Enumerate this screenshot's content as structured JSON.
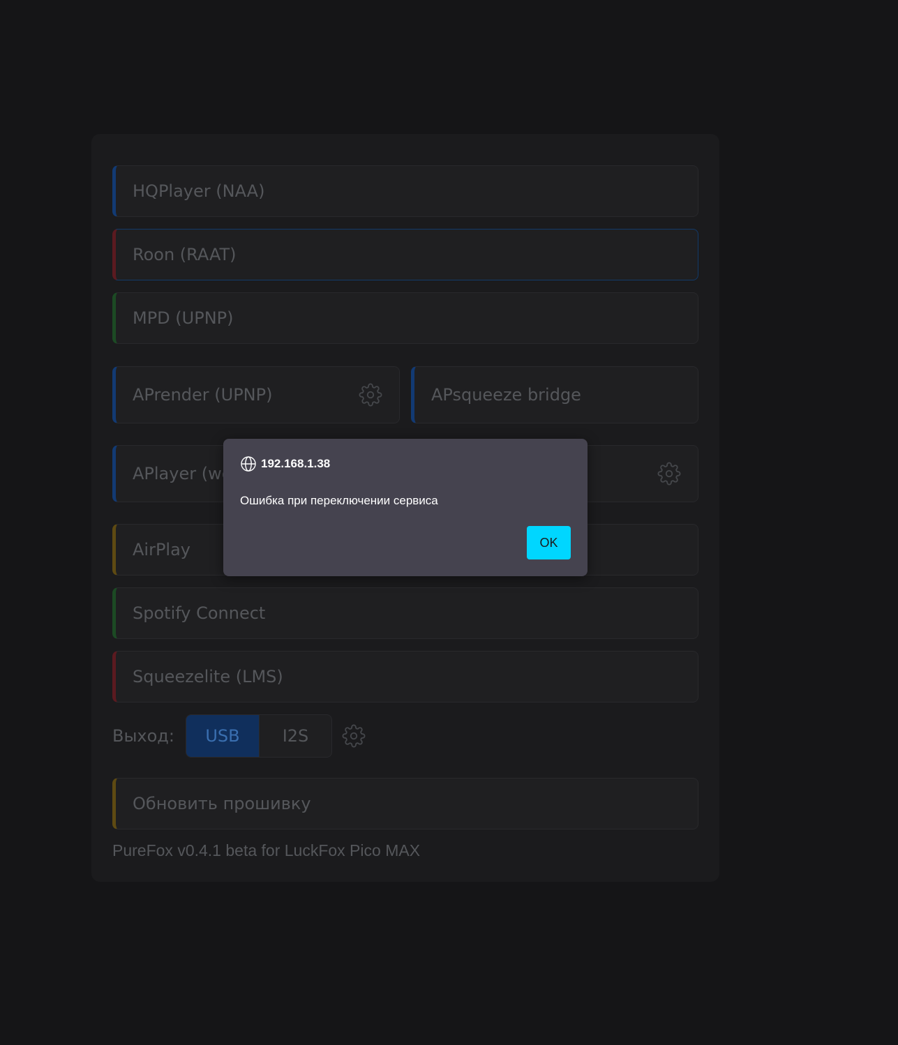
{
  "services": {
    "hqplayer": {
      "label": "HQPlayer (NAA)",
      "accent": "#123a73"
    },
    "roon": {
      "label": "Roon (RAAT)",
      "accent": "#5b1a20"
    },
    "mpd": {
      "label": "MPD (UPNP)",
      "accent": "#1c4a24"
    },
    "aprender": {
      "label": "APrender (UPNP)",
      "accent": "#123a73"
    },
    "apsqueeze": {
      "label": "APsqueeze bridge",
      "accent": "#123a73"
    },
    "aplayer": {
      "label": "APlayer (web)",
      "accent": "#123a73"
    },
    "airplay": {
      "label": "AirPlay",
      "accent": "#5e4a12"
    },
    "spotify": {
      "label": "Spotify Connect",
      "accent": "#1c4a24"
    },
    "squeezelite": {
      "label": "Squeezelite (LMS)",
      "accent": "#5b1a20"
    }
  },
  "output": {
    "label": "Выход:",
    "options": [
      "USB",
      "I2S"
    ],
    "selected": "USB"
  },
  "firmware": {
    "label": "Обновить прошивку",
    "accent": "#5e4a12"
  },
  "footer": {
    "version": "PureFox v0.4.1 beta for LuckFox Pico MAX"
  },
  "dialog": {
    "origin": "192.168.1.38",
    "message": "Ошибка при переключении сервиса",
    "ok_label": "OK",
    "ok_color": "#00d6ff"
  },
  "icons": [
    "gear-icon",
    "globe-icon"
  ]
}
